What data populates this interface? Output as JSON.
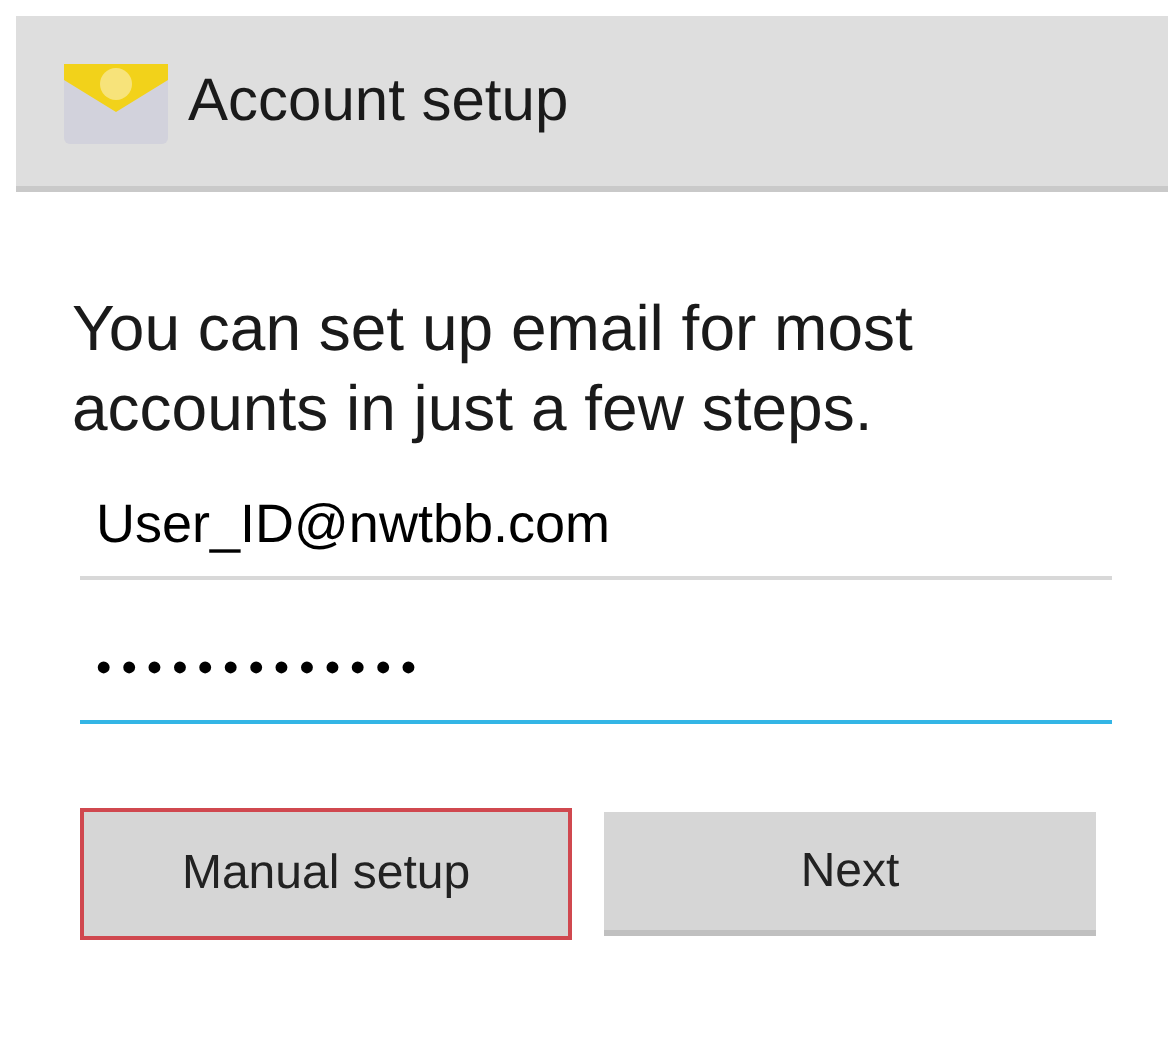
{
  "action_bar": {
    "title": "Account setup"
  },
  "intro": "You can set up email for most accounts in just a few steps.",
  "fields": [
    {
      "kind": "email",
      "value": "User_ID@nwtbb.com",
      "focused": false
    },
    {
      "kind": "password",
      "value": "•••••••••••••",
      "focused": true
    }
  ],
  "buttons": [
    {
      "label": "Manual setup",
      "highlighted": true
    },
    {
      "label": "Next",
      "highlighted": false
    }
  ]
}
